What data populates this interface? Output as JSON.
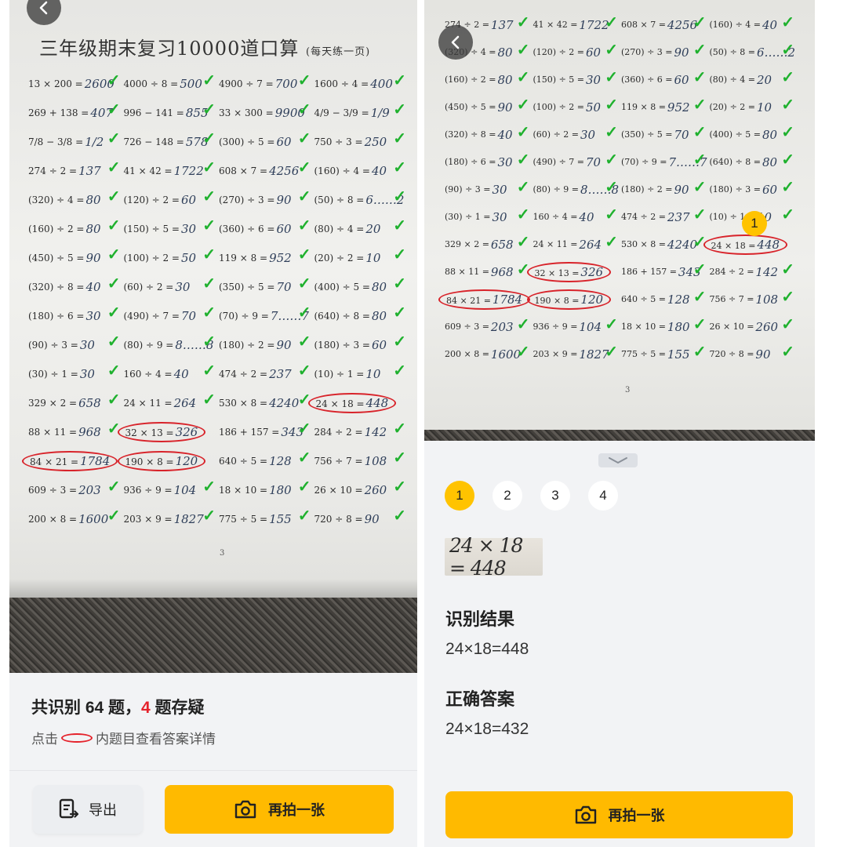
{
  "left": {
    "title": "三年级期末复习10000道口算",
    "subtitle": "(每天练一页)",
    "page_number": "3",
    "rows": [
      [
        {
          "q": "13 × 200 =",
          "a": "2600",
          "ok": true
        },
        {
          "q": "4000 ÷ 8 =",
          "a": "500",
          "ok": true
        },
        {
          "q": "4900 ÷ 7 =",
          "a": "700",
          "ok": true
        },
        {
          "q": "1600 ÷ 4 =",
          "a": "400",
          "ok": true
        }
      ],
      [
        {
          "q": "269 + 138 =",
          "a": "407",
          "ok": true
        },
        {
          "q": "996 − 141 =",
          "a": "855",
          "ok": true
        },
        {
          "q": "33 × 300 =",
          "a": "9900",
          "ok": true
        },
        {
          "q": "4/9 − 3/9 =",
          "a": "1/9",
          "ok": true
        }
      ],
      [
        {
          "q": "7/8 − 3/8 =",
          "a": "1/2",
          "ok": true
        },
        {
          "q": "726 − 148 =",
          "a": "578",
          "ok": true
        },
        {
          "q": "(300) ÷ 5 =",
          "a": "60",
          "ok": true
        },
        {
          "q": "750 ÷ 3 =",
          "a": "250",
          "ok": true
        }
      ],
      [
        {
          "q": "274 ÷ 2 =",
          "a": "137",
          "ok": true
        },
        {
          "q": "41 × 42 =",
          "a": "1722",
          "ok": true
        },
        {
          "q": "608 × 7 =",
          "a": "4256",
          "ok": true
        },
        {
          "q": "(160) ÷ 4 =",
          "a": "40",
          "ok": true
        }
      ],
      [
        {
          "q": "(320) ÷ 4 =",
          "a": "80",
          "ok": true
        },
        {
          "q": "(120) ÷ 2 =",
          "a": "60",
          "ok": true
        },
        {
          "q": "(270) ÷ 3 =",
          "a": "90",
          "ok": true
        },
        {
          "q": "(50) ÷ 8 =",
          "a": "6……2",
          "ok": true
        }
      ],
      [
        {
          "q": "(160) ÷ 2 =",
          "a": "80",
          "ok": true
        },
        {
          "q": "(150) ÷ 5 =",
          "a": "30",
          "ok": true
        },
        {
          "q": "(360) ÷ 6 =",
          "a": "60",
          "ok": true
        },
        {
          "q": "(80) ÷ 4 =",
          "a": "20",
          "ok": true
        }
      ],
      [
        {
          "q": "(450) ÷ 5 =",
          "a": "90",
          "ok": true
        },
        {
          "q": "(100) ÷ 2 =",
          "a": "50",
          "ok": true
        },
        {
          "q": "119 × 8 =",
          "a": "952",
          "ok": true
        },
        {
          "q": "(20) ÷ 2 =",
          "a": "10",
          "ok": true
        }
      ],
      [
        {
          "q": "(320) ÷ 8 =",
          "a": "40",
          "ok": true
        },
        {
          "q": "(60) ÷ 2 =",
          "a": "30",
          "ok": true
        },
        {
          "q": "(350) ÷ 5 =",
          "a": "70",
          "ok": true
        },
        {
          "q": "(400) ÷ 5 =",
          "a": "80",
          "ok": true
        }
      ],
      [
        {
          "q": "(180) ÷ 6 =",
          "a": "30",
          "ok": true
        },
        {
          "q": "(490) ÷ 7 =",
          "a": "70",
          "ok": true
        },
        {
          "q": "(70) ÷ 9 =",
          "a": "7……7",
          "ok": true
        },
        {
          "q": "(640) ÷ 8 =",
          "a": "80",
          "ok": true
        }
      ],
      [
        {
          "q": "(90) ÷ 3 =",
          "a": "30",
          "ok": true
        },
        {
          "q": "(80) ÷ 9 =",
          "a": "8……8",
          "ok": true
        },
        {
          "q": "(180) ÷ 2 =",
          "a": "90",
          "ok": true
        },
        {
          "q": "(180) ÷ 3 =",
          "a": "60",
          "ok": true
        }
      ],
      [
        {
          "q": "(30) ÷ 1 =",
          "a": "30",
          "ok": true
        },
        {
          "q": "160 ÷ 4 =",
          "a": "40",
          "ok": true
        },
        {
          "q": "474 ÷ 2 =",
          "a": "237",
          "ok": true
        },
        {
          "q": "(10) ÷ 1 =",
          "a": "10",
          "ok": true
        }
      ],
      [
        {
          "q": "329 × 2 =",
          "a": "658",
          "ok": true
        },
        {
          "q": "24 × 11 =",
          "a": "264",
          "ok": true
        },
        {
          "q": "530 × 8 =",
          "a": "4240",
          "ok": true
        },
        {
          "q": "24 × 18 =",
          "a": "448",
          "ok": false
        }
      ],
      [
        {
          "q": "88 × 11 =",
          "a": "968",
          "ok": true
        },
        {
          "q": "32 × 13 =",
          "a": "326",
          "ok": false
        },
        {
          "q": "186 + 157 =",
          "a": "343",
          "ok": true
        },
        {
          "q": "284 ÷ 2 =",
          "a": "142",
          "ok": true
        }
      ],
      [
        {
          "q": "84 × 21 =",
          "a": "1784",
          "ok": false
        },
        {
          "q": "190 × 8 =",
          "a": "120",
          "ok": false
        },
        {
          "q": "640 ÷ 5 =",
          "a": "128",
          "ok": true
        },
        {
          "q": "756 ÷ 7 =",
          "a": "108",
          "ok": true
        }
      ],
      [
        {
          "q": "609 ÷ 3 =",
          "a": "203",
          "ok": true
        },
        {
          "q": "936 ÷ 9 =",
          "a": "104",
          "ok": true
        },
        {
          "q": "18 × 10 =",
          "a": "180",
          "ok": true
        },
        {
          "q": "26 × 10 =",
          "a": "260",
          "ok": true
        }
      ],
      [
        {
          "q": "200 × 8 =",
          "a": "1600",
          "ok": true
        },
        {
          "q": "203 × 9 =",
          "a": "1827",
          "ok": true
        },
        {
          "q": "775 ÷ 5 =",
          "a": "155",
          "ok": true
        },
        {
          "q": "720 ÷ 8 =",
          "a": "90",
          "ok": true
        }
      ]
    ],
    "summary_prefix": "共识别 64 题，",
    "summary_count": "4",
    "summary_suffix": " 题存疑",
    "hint_before": "点击",
    "hint_after": "内题目查看答案详情",
    "export_label": "导出",
    "retake_label": "再拍一张"
  },
  "right": {
    "page_number": "3",
    "badge": "1",
    "rows": [
      [
        {
          "q": "274 ÷ 2 =",
          "a": "137",
          "ok": true
        },
        {
          "q": "41 × 42 =",
          "a": "1722",
          "ok": true
        },
        {
          "q": "608 × 7 =",
          "a": "4256",
          "ok": true
        },
        {
          "q": "(160) ÷ 4 =",
          "a": "40",
          "ok": true
        }
      ],
      [
        {
          "q": "(320) ÷ 4 =",
          "a": "80",
          "ok": true
        },
        {
          "q": "(120) ÷ 2 =",
          "a": "60",
          "ok": true
        },
        {
          "q": "(270) ÷ 3 =",
          "a": "90",
          "ok": true
        },
        {
          "q": "(50) ÷ 8 =",
          "a": "6……2",
          "ok": true
        }
      ],
      [
        {
          "q": "(160) ÷ 2 =",
          "a": "80",
          "ok": true
        },
        {
          "q": "(150) ÷ 5 =",
          "a": "30",
          "ok": true
        },
        {
          "q": "(360) ÷ 6 =",
          "a": "60",
          "ok": true
        },
        {
          "q": "(80) ÷ 4 =",
          "a": "20",
          "ok": true
        }
      ],
      [
        {
          "q": "(450) ÷ 5 =",
          "a": "90",
          "ok": true
        },
        {
          "q": "(100) ÷ 2 =",
          "a": "50",
          "ok": true
        },
        {
          "q": "119 × 8 =",
          "a": "952",
          "ok": true
        },
        {
          "q": "(20) ÷ 2 =",
          "a": "10",
          "ok": true
        }
      ],
      [
        {
          "q": "(320) ÷ 8 =",
          "a": "40",
          "ok": true
        },
        {
          "q": "(60) ÷ 2 =",
          "a": "30",
          "ok": true
        },
        {
          "q": "(350) ÷ 5 =",
          "a": "70",
          "ok": true
        },
        {
          "q": "(400) ÷ 5 =",
          "a": "80",
          "ok": true
        }
      ],
      [
        {
          "q": "(180) ÷ 6 =",
          "a": "30",
          "ok": true
        },
        {
          "q": "(490) ÷ 7 =",
          "a": "70",
          "ok": true
        },
        {
          "q": "(70) ÷ 9 =",
          "a": "7……7",
          "ok": true
        },
        {
          "q": "(640) ÷ 8 =",
          "a": "80",
          "ok": true
        }
      ],
      [
        {
          "q": "(90) ÷ 3 =",
          "a": "30",
          "ok": true
        },
        {
          "q": "(80) ÷ 9 =",
          "a": "8……8",
          "ok": true
        },
        {
          "q": "(180) ÷ 2 =",
          "a": "90",
          "ok": true
        },
        {
          "q": "(180) ÷ 3 =",
          "a": "60",
          "ok": true
        }
      ],
      [
        {
          "q": "(30) ÷ 1 =",
          "a": "30",
          "ok": true
        },
        {
          "q": "160 ÷ 4 =",
          "a": "40",
          "ok": true
        },
        {
          "q": "474 ÷ 2 =",
          "a": "237",
          "ok": true
        },
        {
          "q": "(10) ÷ 1 =",
          "a": "10",
          "ok": true
        }
      ],
      [
        {
          "q": "329 × 2 =",
          "a": "658",
          "ok": true
        },
        {
          "q": "24 × 11 =",
          "a": "264",
          "ok": true
        },
        {
          "q": "530 × 8 =",
          "a": "4240",
          "ok": true
        },
        {
          "q": "24 × 18 =",
          "a": "448",
          "ok": false
        }
      ],
      [
        {
          "q": "88 × 11 =",
          "a": "968",
          "ok": true
        },
        {
          "q": "32 × 13 =",
          "a": "326",
          "ok": false
        },
        {
          "q": "186 + 157 =",
          "a": "343",
          "ok": true
        },
        {
          "q": "284 ÷ 2 =",
          "a": "142",
          "ok": true
        }
      ],
      [
        {
          "q": "84 × 21 =",
          "a": "1784",
          "ok": false
        },
        {
          "q": "190 × 8 =",
          "a": "120",
          "ok": false
        },
        {
          "q": "640 ÷ 5 =",
          "a": "128",
          "ok": true
        },
        {
          "q": "756 ÷ 7 =",
          "a": "108",
          "ok": true
        }
      ],
      [
        {
          "q": "609 ÷ 3 =",
          "a": "203",
          "ok": true
        },
        {
          "q": "936 ÷ 9 =",
          "a": "104",
          "ok": true
        },
        {
          "q": "18 × 10 =",
          "a": "180",
          "ok": true
        },
        {
          "q": "26 × 10 =",
          "a": "260",
          "ok": true
        }
      ],
      [
        {
          "q": "200 × 8 =",
          "a": "1600",
          "ok": true
        },
        {
          "q": "203 × 9 =",
          "a": "1827",
          "ok": true
        },
        {
          "q": "775 ÷ 5 =",
          "a": "155",
          "ok": true
        },
        {
          "q": "720 ÷ 8 =",
          "a": "90",
          "ok": true
        }
      ]
    ],
    "tabs": [
      "1",
      "2",
      "3",
      "4"
    ],
    "active_tab": "1",
    "crop_text": "24 × 18 = 448",
    "recognized_heading": "识别结果",
    "recognized_value": "24×18=448",
    "correct_heading": "正确答案",
    "correct_value": "24×18=432",
    "retake_label": "再拍一张"
  },
  "colors": {
    "accent": "#ffba00",
    "badge": "#ffc300",
    "error": "#e5222b",
    "check": "#1fb12e",
    "panel_bg": "#f2f3f5"
  },
  "icons": {
    "back": "chevron-left-icon",
    "check": "check-icon",
    "camera": "camera-icon",
    "export": "export-doc-icon",
    "collapse": "chevron-down-icon"
  }
}
